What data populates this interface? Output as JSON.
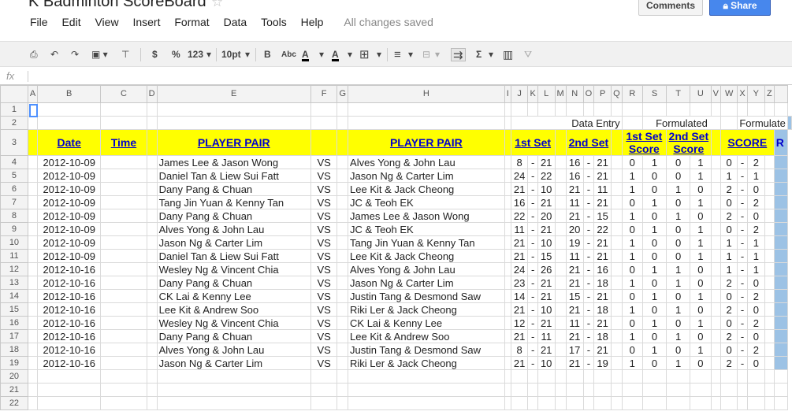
{
  "app": {
    "title": "K Badminton ScoreBoard",
    "comments_label": "Comments",
    "share_label": "Share",
    "saved_status": "All changes saved"
  },
  "menu": [
    "File",
    "Edit",
    "View",
    "Insert",
    "Format",
    "Data",
    "Tools",
    "Help"
  ],
  "toolbar": {
    "currency": "$",
    "percent": "%",
    "number_format": "123",
    "font_size": "10pt",
    "bold": "B",
    "strikethrough": "Abc",
    "text_color": "A",
    "fill_color": "A",
    "sum": "Σ"
  },
  "formula_bar": {
    "fx_label": "fx",
    "value": ""
  },
  "columns": [
    "A",
    "B",
    "C",
    "D",
    "E",
    "F",
    "G",
    "H",
    "I",
    "J",
    "K",
    "L",
    "M",
    "N",
    "O",
    "P",
    "Q",
    "R",
    "S",
    "T",
    "U",
    "V",
    "W",
    "X",
    "Y",
    "Z"
  ],
  "rows": [
    "1",
    "2",
    "3",
    "4",
    "5",
    "6",
    "7",
    "8",
    "9",
    "10",
    "11",
    "12",
    "13",
    "14",
    "15",
    "16",
    "17",
    "18",
    "19",
    "20",
    "21",
    "22"
  ],
  "row2_headers": {
    "data_entry": "Data Entry",
    "formulated": "Formulated",
    "formulated2": "Formulate"
  },
  "row3_headers": {
    "date": "Date",
    "time": "Time",
    "player_pair_1": "PLAYER PAIR",
    "player_pair_2": "PLAYER PAIR",
    "set1": "1st Set",
    "set2": "2nd Set",
    "set1_score": "1st Set Score",
    "set2_score": "2nd Set Score",
    "score": "SCORE",
    "extra": "R"
  },
  "matches": [
    {
      "date": "2012-10-09",
      "time": "",
      "pair1": "James Lee & Jason Wong",
      "vs": "VS",
      "pair2": "Alves Yong & John Lau",
      "s1a": "8",
      "s1d": "-",
      "s1b": "21",
      "s2a": "16",
      "s2d": "-",
      "s2b": "21",
      "r": "0",
      "s": "1",
      "t": "0",
      "u": "1",
      "w": "0",
      "x": "-",
      "y": "2"
    },
    {
      "date": "2012-10-09",
      "time": "",
      "pair1": "Daniel Tan & Liew Sui Fatt",
      "vs": "VS",
      "pair2": "Jason Ng & Carter Lim",
      "s1a": "24",
      "s1d": "-",
      "s1b": "22",
      "s2a": "16",
      "s2d": "-",
      "s2b": "21",
      "r": "1",
      "s": "0",
      "t": "0",
      "u": "1",
      "w": "1",
      "x": "-",
      "y": "1"
    },
    {
      "date": "2012-10-09",
      "time": "",
      "pair1": "Dany Pang & Chuan",
      "vs": "VS",
      "pair2": "Lee Kit & Jack Cheong",
      "s1a": "21",
      "s1d": "-",
      "s1b": "10",
      "s2a": "21",
      "s2d": "-",
      "s2b": "11",
      "r": "1",
      "s": "0",
      "t": "1",
      "u": "0",
      "w": "2",
      "x": "-",
      "y": "0"
    },
    {
      "date": "2012-10-09",
      "time": "",
      "pair1": "Tang Jin Yuan & Kenny Tan",
      "vs": "VS",
      "pair2": "JC & Teoh EK",
      "s1a": "16",
      "s1d": "-",
      "s1b": "21",
      "s2a": "11",
      "s2d": "-",
      "s2b": "21",
      "r": "0",
      "s": "1",
      "t": "0",
      "u": "1",
      "w": "0",
      "x": "-",
      "y": "2"
    },
    {
      "date": "2012-10-09",
      "time": "",
      "pair1": "Dany Pang & Chuan",
      "vs": "VS",
      "pair2": "James Lee & Jason Wong",
      "s1a": "22",
      "s1d": "-",
      "s1b": "20",
      "s2a": "21",
      "s2d": "-",
      "s2b": "15",
      "r": "1",
      "s": "0",
      "t": "1",
      "u": "0",
      "w": "2",
      "x": "-",
      "y": "0"
    },
    {
      "date": "2012-10-09",
      "time": "",
      "pair1": "Alves Yong & John Lau",
      "vs": "VS",
      "pair2": "JC & Teoh EK",
      "s1a": "11",
      "s1d": "-",
      "s1b": "21",
      "s2a": "20",
      "s2d": "-",
      "s2b": "22",
      "r": "0",
      "s": "1",
      "t": "0",
      "u": "1",
      "w": "0",
      "x": "-",
      "y": "2"
    },
    {
      "date": "2012-10-09",
      "time": "",
      "pair1": "Jason Ng & Carter Lim",
      "vs": "VS",
      "pair2": "Tang Jin Yuan & Kenny Tan",
      "s1a": "21",
      "s1d": "-",
      "s1b": "10",
      "s2a": "19",
      "s2d": "-",
      "s2b": "21",
      "r": "1",
      "s": "0",
      "t": "0",
      "u": "1",
      "w": "1",
      "x": "-",
      "y": "1"
    },
    {
      "date": "2012-10-09",
      "time": "",
      "pair1": "Daniel Tan & Liew Sui Fatt",
      "vs": "VS",
      "pair2": "Lee Kit & Jack Cheong",
      "s1a": "21",
      "s1d": "-",
      "s1b": "15",
      "s2a": "11",
      "s2d": "-",
      "s2b": "21",
      "r": "1",
      "s": "0",
      "t": "0",
      "u": "1",
      "w": "1",
      "x": "-",
      "y": "1"
    },
    {
      "date": "2012-10-16",
      "time": "",
      "pair1": "Wesley Ng & Vincent Chia",
      "vs": "VS",
      "pair2": "Alves Yong & John Lau",
      "s1a": "24",
      "s1d": "-",
      "s1b": "26",
      "s2a": "21",
      "s2d": "-",
      "s2b": "16",
      "r": "0",
      "s": "1",
      "t": "1",
      "u": "0",
      "w": "1",
      "x": "-",
      "y": "1"
    },
    {
      "date": "2012-10-16",
      "time": "",
      "pair1": "Dany Pang & Chuan",
      "vs": "VS",
      "pair2": "Jason Ng & Carter Lim",
      "s1a": "23",
      "s1d": "-",
      "s1b": "21",
      "s2a": "21",
      "s2d": "-",
      "s2b": "18",
      "r": "1",
      "s": "0",
      "t": "1",
      "u": "0",
      "w": "2",
      "x": "-",
      "y": "0"
    },
    {
      "date": "2012-10-16",
      "time": "",
      "pair1": "CK Lai & Kenny Lee",
      "vs": "VS",
      "pair2": "Justin Tang & Desmond Saw",
      "s1a": "14",
      "s1d": "-",
      "s1b": "21",
      "s2a": "15",
      "s2d": "-",
      "s2b": "21",
      "r": "0",
      "s": "1",
      "t": "0",
      "u": "1",
      "w": "0",
      "x": "-",
      "y": "2"
    },
    {
      "date": "2012-10-16",
      "time": "",
      "pair1": "Lee Kit & Andrew Soo",
      "vs": "VS",
      "pair2": "Riki Ler & Jack Cheong",
      "s1a": "21",
      "s1d": "-",
      "s1b": "10",
      "s2a": "21",
      "s2d": "-",
      "s2b": "18",
      "r": "1",
      "s": "0",
      "t": "1",
      "u": "0",
      "w": "2",
      "x": "-",
      "y": "0"
    },
    {
      "date": "2012-10-16",
      "time": "",
      "pair1": "Wesley Ng & Vincent Chia",
      "vs": "VS",
      "pair2": "CK Lai & Kenny Lee",
      "s1a": "12",
      "s1d": "-",
      "s1b": "21",
      "s2a": "11",
      "s2d": "-",
      "s2b": "21",
      "r": "0",
      "s": "1",
      "t": "0",
      "u": "1",
      "w": "0",
      "x": "-",
      "y": "2"
    },
    {
      "date": "2012-10-16",
      "time": "",
      "pair1": "Dany Pang & Chuan",
      "vs": "VS",
      "pair2": "Lee Kit & Andrew Soo",
      "s1a": "21",
      "s1d": "-",
      "s1b": "11",
      "s2a": "21",
      "s2d": "-",
      "s2b": "18",
      "r": "1",
      "s": "0",
      "t": "1",
      "u": "0",
      "w": "2",
      "x": "-",
      "y": "0"
    },
    {
      "date": "2012-10-16",
      "time": "",
      "pair1": "Alves Yong & John Lau",
      "vs": "VS",
      "pair2": "Justin Tang & Desmond Saw",
      "s1a": "8",
      "s1d": "-",
      "s1b": "21",
      "s2a": "17",
      "s2d": "-",
      "s2b": "21",
      "r": "0",
      "s": "1",
      "t": "0",
      "u": "1",
      "w": "0",
      "x": "-",
      "y": "2"
    },
    {
      "date": "2012-10-16",
      "time": "",
      "pair1": "Jason Ng & Carter Lim",
      "vs": "VS",
      "pair2": "Riki Ler & Jack Cheong",
      "s1a": "21",
      "s1d": "-",
      "s1b": "10",
      "s2a": "21",
      "s2d": "-",
      "s2b": "19",
      "r": "1",
      "s": "0",
      "t": "1",
      "u": "0",
      "w": "2",
      "x": "-",
      "y": "0"
    }
  ],
  "colors": {
    "header_fill": "#ffff00",
    "header_text": "#0000cc",
    "side_fill": "#9cc2e5",
    "share_button": "#4787ed"
  }
}
